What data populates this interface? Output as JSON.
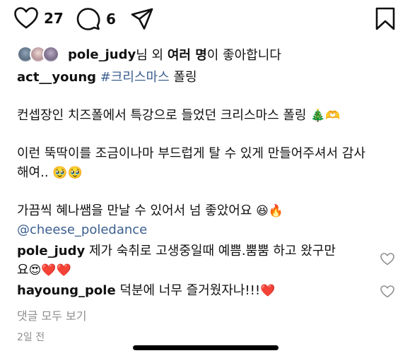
{
  "actions": {
    "like_count": "27",
    "comment_count": "6",
    "icons": [
      "heart-icon",
      "comment-icon",
      "send-icon",
      "bookmark-icon"
    ]
  },
  "likes": {
    "user": "pole_judy",
    "text_a": "님 외 ",
    "text_bold": "여러 명",
    "text_b": "이 좋아합니다"
  },
  "caption": {
    "author": "act__young",
    "hashtag": "#크리스마스",
    "tail": " 폴링",
    "line1": "컨셉장인 치즈폴에서 특강으로 들었던 크리스마스 폴링",
    "line1_emoji": "🎄🫶",
    "line2": "이런 뚝딱이를 조금이나마 부드럽게 탈 수 있게 만들어주셔서 감사",
    "line3": "해여..",
    "line3_emoji": "🥹🥹",
    "line4": "가끔씩 혜나쌤을 만날 수 있어서 넘 좋았어요",
    "line4_emoji": "😆🔥",
    "mention": "@cheese_poledance"
  },
  "comments": [
    {
      "user": "pole_judy",
      "text": " 제가 숙취로 고생중일때 예쁨.뿜뿜 하고 왔구만",
      "cont": "요",
      "emoji": "😍❤️❤️"
    },
    {
      "user": "hayoung_pole",
      "text": " 덕분에 너무 즐거웠자나!!!",
      "emoji": "❤️"
    }
  ],
  "view_all": "댓글 모두 보기",
  "time": "2일 전",
  "colors": {
    "link": "#3b5f8f",
    "muted": "#8e8e8e",
    "heart_red": "#e0245e"
  }
}
